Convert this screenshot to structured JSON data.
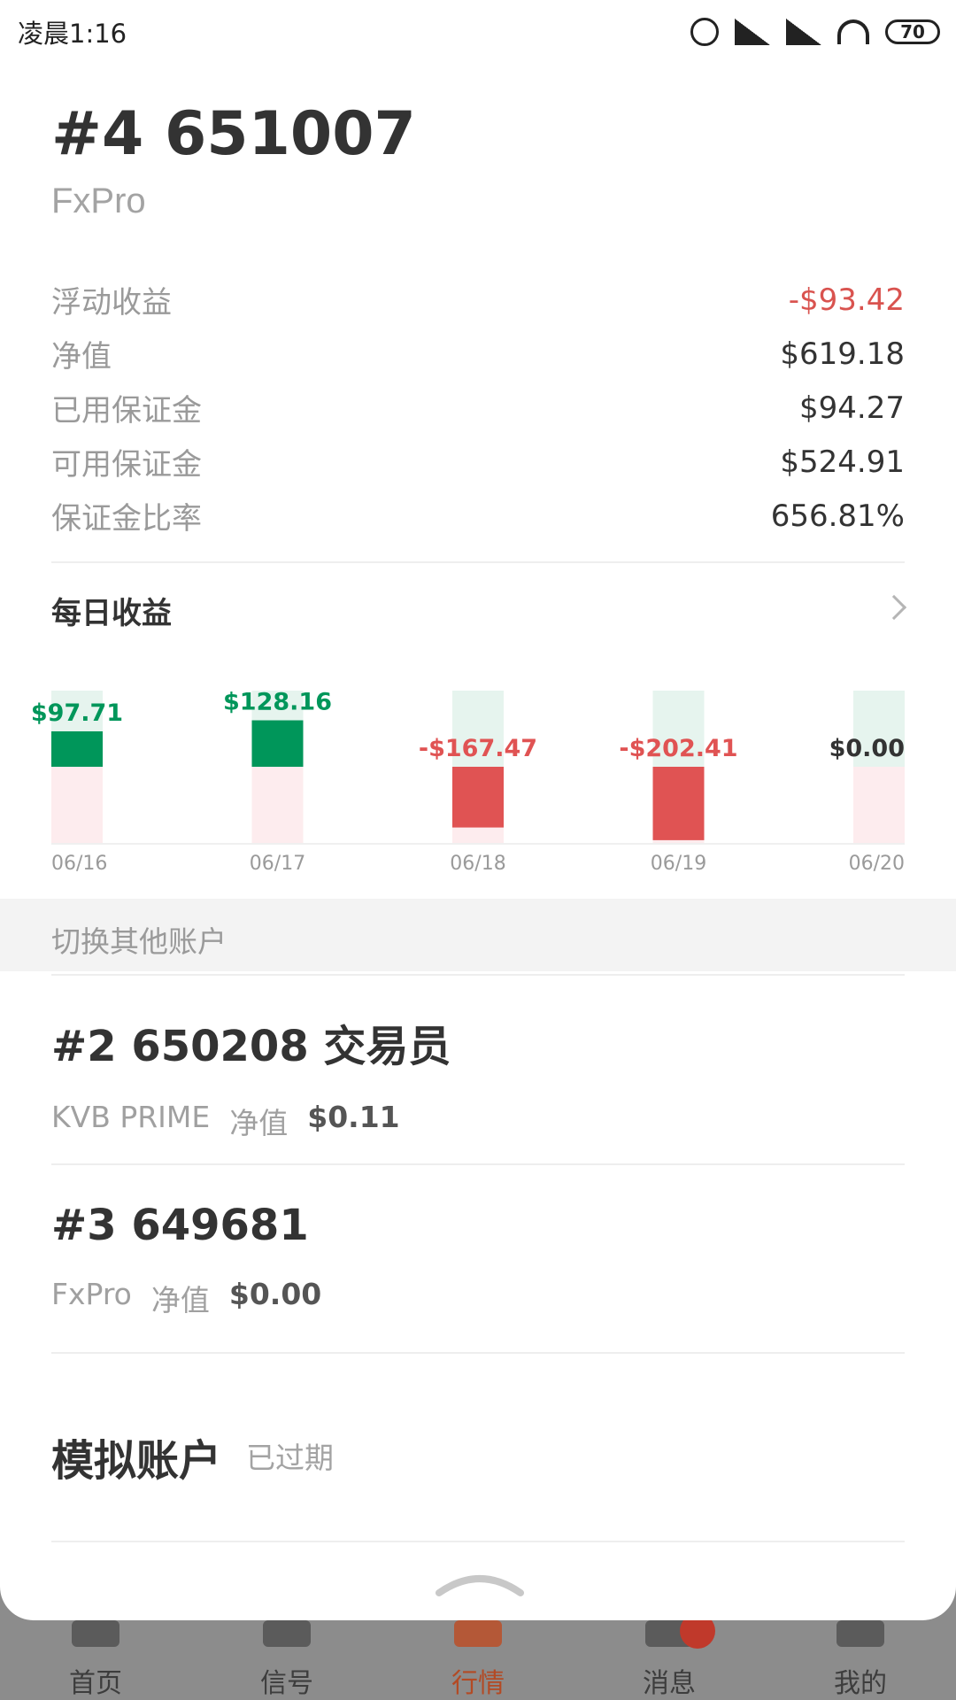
{
  "status_bar": {
    "time": "凌晨1:16",
    "battery": "70"
  },
  "account": {
    "title": "#4 651007",
    "broker": "FxPro"
  },
  "stats": [
    {
      "label": "浮动收益",
      "value": "-$93.42",
      "negative": true
    },
    {
      "label": "净值",
      "value": "$619.18",
      "negative": false
    },
    {
      "label": "已用保证金",
      "value": "$94.27",
      "negative": false
    },
    {
      "label": "可用保证金",
      "value": "$524.91",
      "negative": false
    },
    {
      "label": "保证金比率",
      "value": "656.81%",
      "negative": false
    }
  ],
  "daily_section": {
    "title": "每日收益"
  },
  "chart_data": {
    "type": "bar",
    "categories": [
      "06/16",
      "06/17",
      "06/18",
      "06/19",
      "06/20"
    ],
    "values": [
      97.71,
      128.16,
      -167.47,
      -202.41,
      0.0
    ],
    "value_labels": [
      "$97.71",
      "$128.16",
      "-$167.47",
      "-$202.41",
      "$0.00"
    ],
    "ylim": [
      -210,
      210
    ],
    "colors": {
      "positive": "#00965a",
      "negative": "#e05353",
      "pos_bg": "#e6f4ee",
      "neg_bg": "#fdecee"
    }
  },
  "switch_section": {
    "label": "切换其他账户"
  },
  "other_accounts": [
    {
      "title": "#2 650208 交易员",
      "broker": "KVB PRIME",
      "equity_label": "净值",
      "equity_value": "$0.11"
    },
    {
      "title": "#3 649681",
      "broker": "FxPro",
      "equity_label": "净值",
      "equity_value": "$0.00"
    }
  ],
  "demo": {
    "title": "模拟账户",
    "status": "已过期"
  },
  "bottom_nav": [
    {
      "label": "首页",
      "active": false
    },
    {
      "label": "信号",
      "active": false
    },
    {
      "label": "行情",
      "active": true
    },
    {
      "label": "消息",
      "active": false
    },
    {
      "label": "我的",
      "active": false
    }
  ]
}
